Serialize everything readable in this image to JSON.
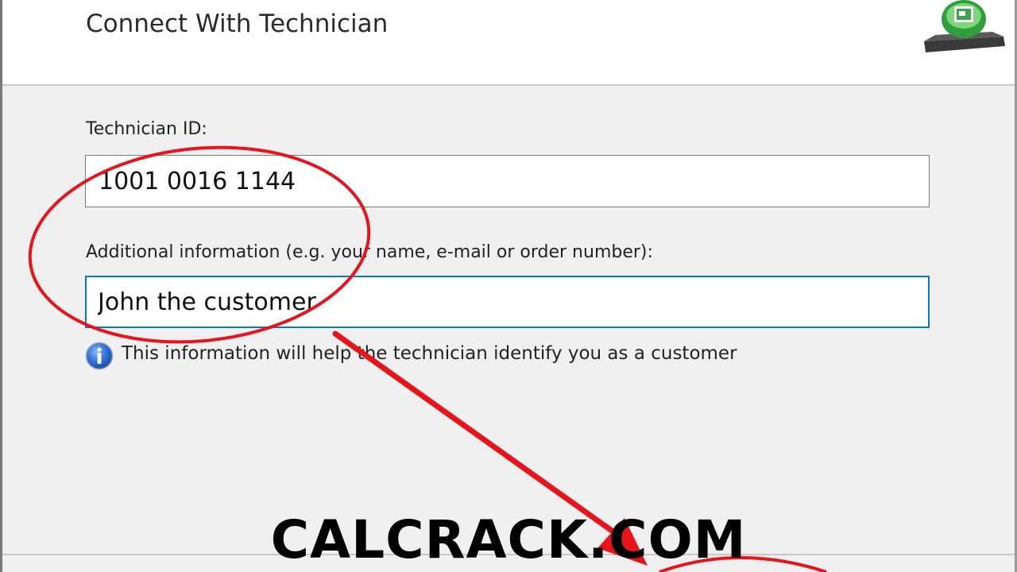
{
  "dialog": {
    "title": "Connect With Technician"
  },
  "form": {
    "technician_id": {
      "label": "Technician ID:",
      "value": "1001 0016 1144"
    },
    "additional_info": {
      "label": "Additional information (e.g. your name, e-mail or order number):",
      "value": "John the customer"
    },
    "hint": "This information will help the technician identify you as a customer"
  },
  "watermark": "CALCRACK.COM",
  "icons": {
    "app_logo": "remote-support-monitor-icon",
    "hint_icon": "info-icon"
  },
  "colors": {
    "focus_border": "#0078d7",
    "annotation_red": "#e8141b",
    "info_icon_blue": "#1a5fc9"
  }
}
